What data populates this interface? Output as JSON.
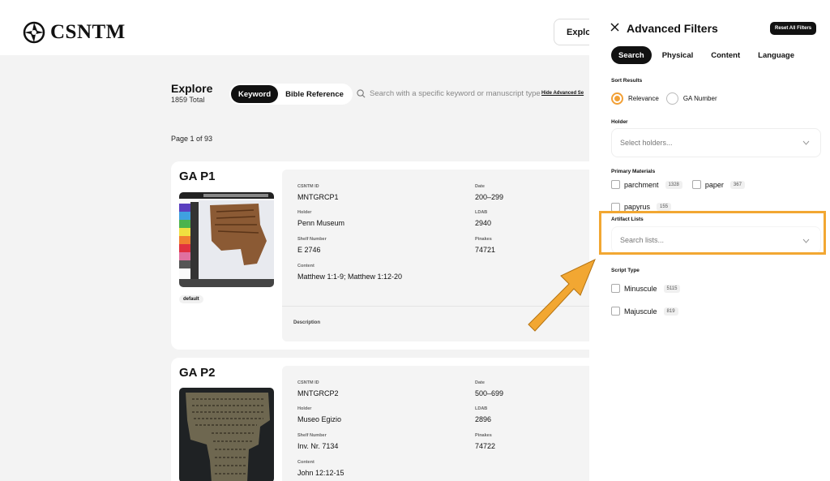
{
  "header": {
    "logo_text": "CSNTM",
    "explore_label": "Explor"
  },
  "explore": {
    "title": "Explore",
    "total": "1859 Total",
    "tabs": [
      "Keyword",
      "Bible Reference"
    ],
    "search_placeholder": "Search with a specific keyword or manuscript type",
    "hide_advanced": "Hide Advanced Se",
    "page_info": "Page 1 of 93"
  },
  "cards": [
    {
      "title": "GA P1",
      "tag": "default",
      "csntm_id_label": "CSNTM ID",
      "csntm_id": "MNTGRCP1",
      "date_label": "Date",
      "date": "200–299",
      "holder_label": "Holder",
      "holder": "Penn Museum",
      "ldab_label": "LDAB",
      "ldab": "2940",
      "shelf_label": "Shelf Number",
      "shelf": "E 2746",
      "pinakes_label": "Pinakes",
      "pinakes": "74721",
      "content_label": "Content",
      "content": "Matthew 1:1-9; Matthew 1:12-20",
      "description_label": "Description"
    },
    {
      "title": "GA P2",
      "csntm_id_label": "CSNTM ID",
      "csntm_id": "MNTGRCP2",
      "date_label": "Date",
      "date": "500–699",
      "holder_label": "Holder",
      "holder": "Museo Egizio",
      "ldab_label": "LDAB",
      "ldab": "2896",
      "shelf_label": "Shelf Number",
      "shelf": "Inv. Nr. 7134",
      "pinakes_label": "Pinakes",
      "pinakes": "74722",
      "content_label": "Content",
      "content": "John 12:12-15"
    }
  ],
  "panel": {
    "title": "Advanced Filters",
    "reset_label": "Reset All Filters",
    "tabs": [
      "Search",
      "Physical",
      "Content",
      "Language"
    ],
    "sort_label": "Sort Results",
    "sort_options": [
      "Relevance",
      "GA Number"
    ],
    "holder_label": "Holder",
    "holder_placeholder": "Select holders...",
    "materials_label": "Primary Materials",
    "materials": [
      {
        "name": "parchment",
        "count": "1328"
      },
      {
        "name": "paper",
        "count": "367"
      },
      {
        "name": "papyrus",
        "count": "155"
      }
    ],
    "artifact_label": "Artifact Lists",
    "artifact_placeholder": "Search lists...",
    "script_label": "Script Type",
    "scripts": [
      {
        "name": "Minuscule",
        "count": "5115"
      },
      {
        "name": "Majuscule",
        "count": "819"
      }
    ]
  },
  "colors": {
    "accent": "#f2a036",
    "highlight": "#f2a732"
  }
}
